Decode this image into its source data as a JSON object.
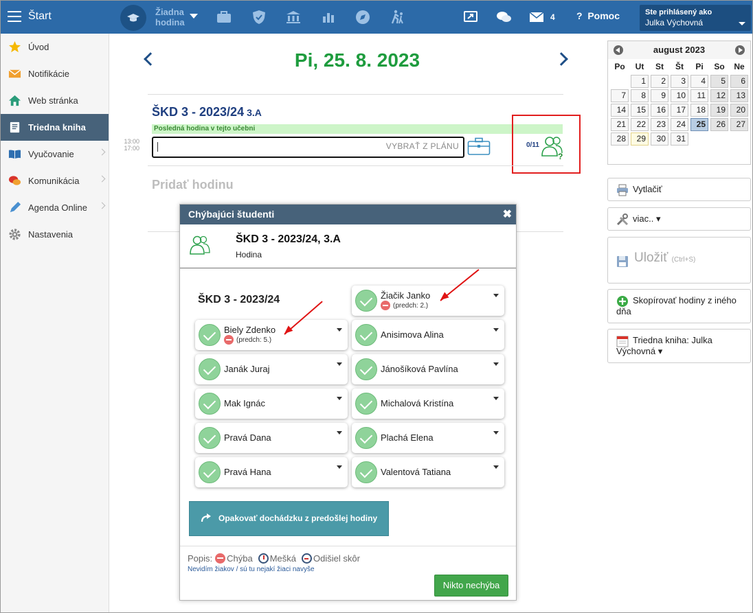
{
  "topbar": {
    "start": "Štart",
    "lesson_line1": "Žiadna",
    "lesson_line2": "hodina",
    "messages_count": "4",
    "help": "Pomoc",
    "user_label": "Ste prihlásený ako",
    "user_name": "Julka Výchovná"
  },
  "sidebar": {
    "items": [
      {
        "label": "Úvod",
        "icon": "star-icon"
      },
      {
        "label": "Notifikácie",
        "icon": "envelope-icon"
      },
      {
        "label": "Web stránka",
        "icon": "home-icon"
      },
      {
        "label": "Triedna kniha",
        "icon": "notebook-icon"
      },
      {
        "label": "Vyučovanie",
        "icon": "open-book-icon"
      },
      {
        "label": "Komunikácia",
        "icon": "chat-icon"
      },
      {
        "label": "Agenda Online",
        "icon": "pen-icon"
      },
      {
        "label": "Nastavenia",
        "icon": "gear-icon"
      }
    ]
  },
  "main": {
    "date": "Pi, 25. 8. 2023",
    "lesson_title": "ŠKD 3 - 2023/24",
    "lesson_class": "3.A",
    "last_lesson_note": "Posledná hodina v tejto učebni",
    "time_from": "13:00",
    "time_to": "17:00",
    "plan_placeholder": "VYBRAŤ Z PLÁNU",
    "attendance_count": "0/11",
    "add_lesson": "Pridať hodinu"
  },
  "calendar": {
    "month": "august 2023",
    "dow": [
      "Po",
      "Ut",
      "St",
      "Št",
      "Pi",
      "So",
      "Ne"
    ],
    "weeks": [
      [
        "",
        "1",
        "2",
        "3",
        "4",
        "5",
        "6"
      ],
      [
        "7",
        "8",
        "9",
        "10",
        "11",
        "12",
        "13"
      ],
      [
        "14",
        "15",
        "16",
        "17",
        "18",
        "19",
        "20"
      ],
      [
        "21",
        "22",
        "23",
        "24",
        "25",
        "26",
        "27"
      ],
      [
        "28",
        "29",
        "30",
        "31",
        "",
        "",
        ""
      ]
    ],
    "selected": "25",
    "today": "29"
  },
  "right": {
    "print": "Vytlačiť",
    "more": "viac.. ▾",
    "save": "Uložiť",
    "save_shortcut": "(Ctrl+S)",
    "copy": "Skopírovať hodiny z iného dňa",
    "classbook": "Triedna kniha: Julka Výchovná ▾"
  },
  "dialog": {
    "title": "Chýbajúci študenti",
    "lesson": "ŠKD 3 - 2023/24, 3.A",
    "type": "Hodina",
    "group": "ŠKD 3 - 2023/24",
    "students": [
      {
        "name": "Žiačik Janko",
        "prev": "(predch: 2.)"
      },
      {
        "name": "Biely Zdenko",
        "prev": "(predch: 5.)"
      },
      {
        "name": "Anisimova Alina",
        "prev": ""
      },
      {
        "name": "Janák Juraj",
        "prev": ""
      },
      {
        "name": "Jánošíková Pavlína",
        "prev": ""
      },
      {
        "name": "Mak Ignác",
        "prev": ""
      },
      {
        "name": "Michalová Kristína",
        "prev": ""
      },
      {
        "name": "Pravá Dana",
        "prev": ""
      },
      {
        "name": "Plachá Elena",
        "prev": ""
      },
      {
        "name": "Pravá Hana",
        "prev": ""
      },
      {
        "name": "Valentová Tatiana",
        "prev": ""
      }
    ],
    "repeat": "Opakovať dochádzku z predošlej hodiny",
    "legend_label": "Popis:",
    "legend_absent": "Chýba",
    "legend_late": "Mešká",
    "legend_left": "Odišiel skôr",
    "legend_link": "Nevidím žiakov / sú tu nejakí žiaci navyše",
    "nobody": "Nikto nechýba"
  }
}
